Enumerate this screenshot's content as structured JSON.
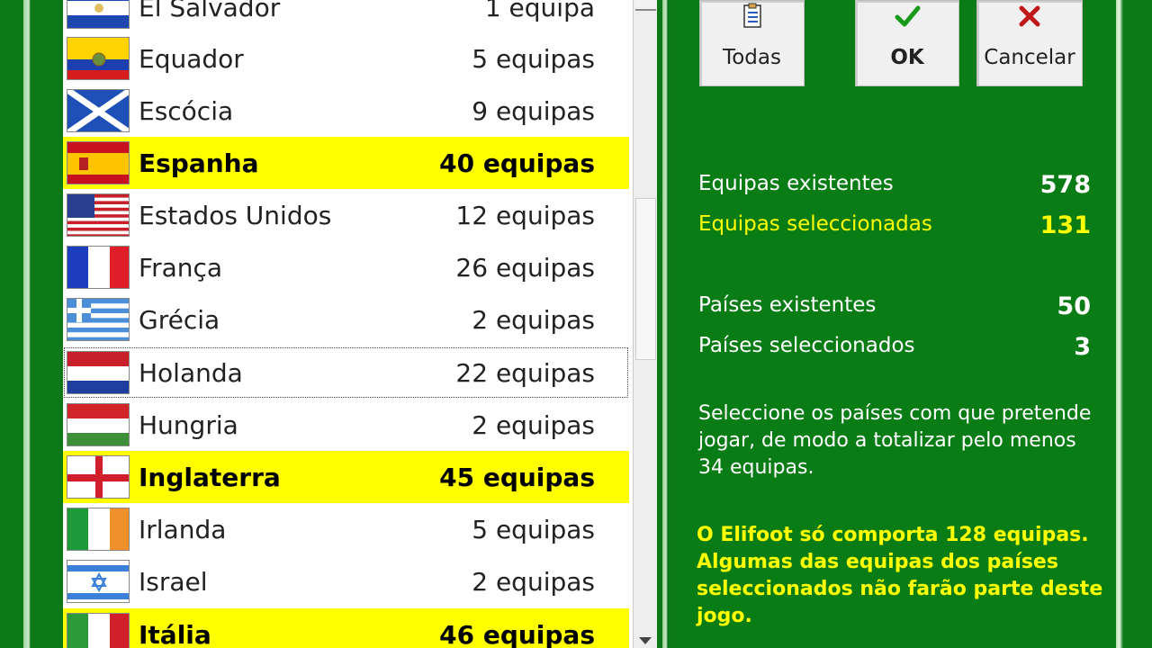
{
  "countries": [
    {
      "name": "El Salvador",
      "count": "1 equipa",
      "selected": false,
      "flag": "el-salvador"
    },
    {
      "name": "Equador",
      "count": "5 equipas",
      "selected": false,
      "flag": "ecuador"
    },
    {
      "name": "Escócia",
      "count": "9 equipas",
      "selected": false,
      "flag": "scotland"
    },
    {
      "name": "Espanha",
      "count": "40 equipas",
      "selected": true,
      "flag": "spain"
    },
    {
      "name": "Estados Unidos",
      "count": "12 equipas",
      "selected": false,
      "flag": "usa"
    },
    {
      "name": "França",
      "count": "26 equipas",
      "selected": false,
      "flag": "france"
    },
    {
      "name": "Grécia",
      "count": "2 equipas",
      "selected": false,
      "flag": "greece"
    },
    {
      "name": "Holanda",
      "count": "22 equipas",
      "selected": false,
      "focused": true,
      "flag": "netherlands"
    },
    {
      "name": "Hungria",
      "count": "2 equipas",
      "selected": false,
      "flag": "hungary"
    },
    {
      "name": "Inglaterra",
      "count": "45 equipas",
      "selected": true,
      "flag": "england"
    },
    {
      "name": "Irlanda",
      "count": "5 equipas",
      "selected": false,
      "flag": "ireland"
    },
    {
      "name": "Israel",
      "count": "2 equipas",
      "selected": false,
      "flag": "israel"
    },
    {
      "name": "Itália",
      "count": "46 equipas",
      "selected": true,
      "flag": "italy"
    }
  ],
  "buttons": {
    "todas": {
      "label": "Todas",
      "icon": "clipboard-list-icon"
    },
    "ok": {
      "label": "OK",
      "icon": "checkmark-icon"
    },
    "cancelar": {
      "label": "Cancelar",
      "icon": "red-x-icon"
    }
  },
  "stats": {
    "equipas_existentes_label": "Equipas existentes",
    "equipas_existentes_value": "578",
    "equipas_seleccionadas_label": "Equipas seleccionadas",
    "equipas_seleccionadas_value": "131",
    "paises_existentes_label": "Países existentes",
    "paises_existentes_value": "50",
    "paises_seleccionados_label": "Países seleccionados",
    "paises_seleccionados_value": "3"
  },
  "instructions": {
    "line1": "Seleccione os países com que pretende",
    "line2": "jogar, de modo a totalizar pelo menos",
    "line3": "34 equipas."
  },
  "warning": {
    "line1": "O Elifoot só comporta 128 equipas.",
    "line2": "Algumas das equipas dos países",
    "line3": "seleccionados não farão parte deste",
    "line4": "jogo."
  },
  "colors": {
    "background_green": "#0a7c16",
    "selected_row": "#ffff00",
    "highlight_text": "#ffff00"
  }
}
